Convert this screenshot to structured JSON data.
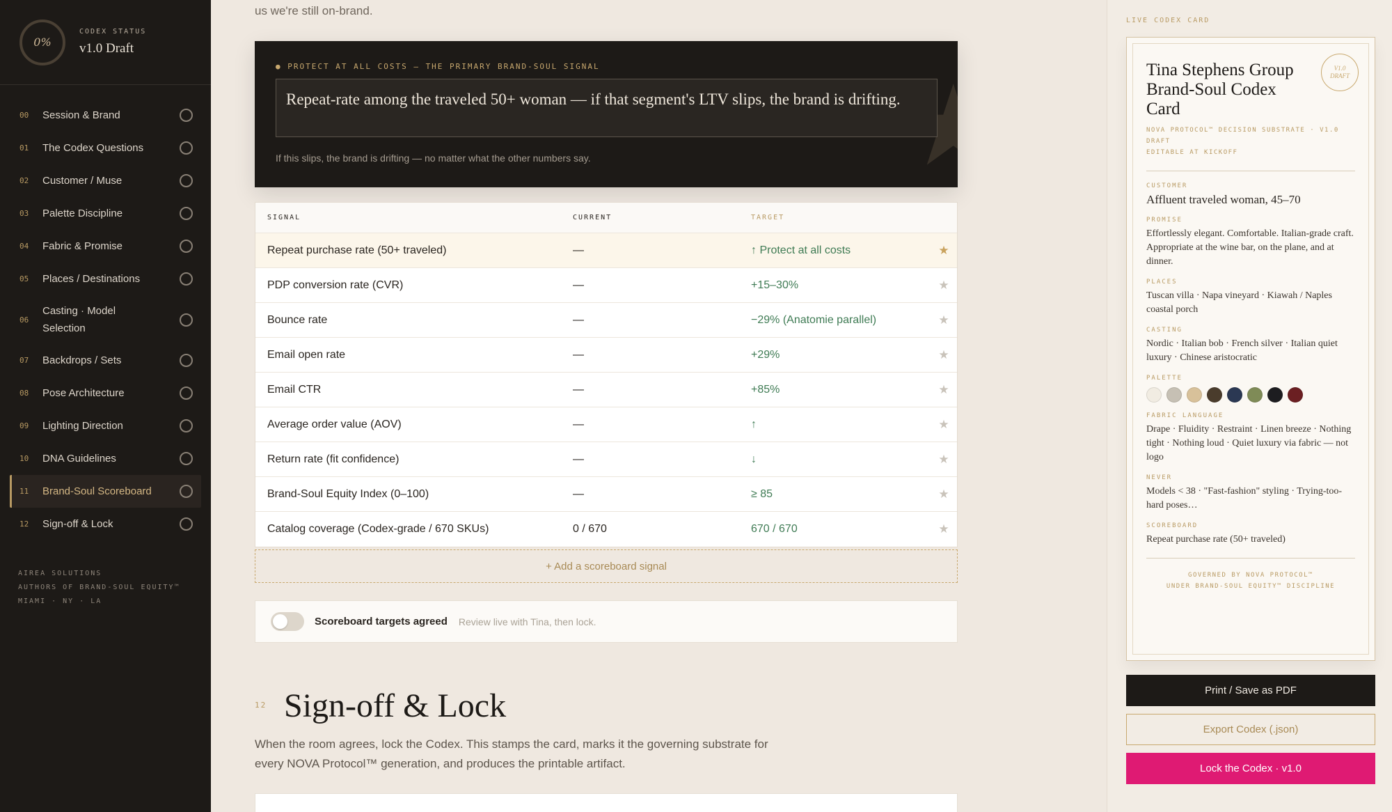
{
  "sidebar": {
    "status_percent": "0%",
    "status_label": "CODEX STATUS",
    "status_value": "v1.0 Draft",
    "items": [
      {
        "num": "00",
        "label": "Session & Brand"
      },
      {
        "num": "01",
        "label": "The Codex Questions"
      },
      {
        "num": "02",
        "label": "Customer / Muse"
      },
      {
        "num": "03",
        "label": "Palette Discipline"
      },
      {
        "num": "04",
        "label": "Fabric & Promise"
      },
      {
        "num": "05",
        "label": "Places / Destinations"
      },
      {
        "num": "06",
        "label": "Casting · Model Selection"
      },
      {
        "num": "07",
        "label": "Backdrops / Sets"
      },
      {
        "num": "08",
        "label": "Pose Architecture"
      },
      {
        "num": "09",
        "label": "Lighting Direction"
      },
      {
        "num": "10",
        "label": "DNA Guidelines"
      },
      {
        "num": "11",
        "label": "Brand-Soul Scoreboard",
        "active": true
      },
      {
        "num": "12",
        "label": "Sign-off & Lock"
      }
    ],
    "company": [
      "AIREA SOLUTIONS",
      "AUTHORS OF BRAND-SOUL EQUITY™",
      "MIAMI · NY · LA"
    ]
  },
  "main": {
    "intro_tail": "us we're still on-brand.",
    "primary": {
      "eyebrow": "● PROTECT AT ALL COSTS — THE PRIMARY BRAND-SOUL SIGNAL",
      "quote": "Repeat-rate among the traveled 50+ woman — if that segment's LTV slips, the brand is drifting.",
      "note": "If this slips, the brand is drifting — no matter what the other numbers say."
    },
    "table": {
      "headers": [
        "SIGNAL",
        "CURRENT",
        "TARGET"
      ],
      "rows": [
        {
          "signal": "Repeat purchase rate (50+ traveled)",
          "current": "—",
          "target": "↑ Protect at all costs",
          "highlight": true
        },
        {
          "signal": "PDP conversion rate (CVR)",
          "current": "—",
          "target": "+15–30%"
        },
        {
          "signal": "Bounce rate",
          "current": "—",
          "target": "−29% (Anatomie parallel)"
        },
        {
          "signal": "Email open rate",
          "current": "—",
          "target": "+29%"
        },
        {
          "signal": "Email CTR",
          "current": "—",
          "target": "+85%"
        },
        {
          "signal": "Average order value (AOV)",
          "current": "—",
          "target": "↑"
        },
        {
          "signal": "Return rate (fit confidence)",
          "current": "—",
          "target": "↓"
        },
        {
          "signal": "Brand-Soul Equity Index (0–100)",
          "current": "—",
          "target": "≥ 85"
        },
        {
          "signal": "Catalog coverage (Codex-grade / 670 SKUs)",
          "current": "0 / 670",
          "target": "670 / 670"
        }
      ]
    },
    "add_signal": "+ Add a scoreboard signal",
    "agree_label": "Scoreboard targets agreed",
    "agree_hint": "Review live with Tina, then lock.",
    "section_num": "12",
    "section_title": "Sign-off & Lock",
    "section_desc": "When the room agrees, lock the Codex. This stamps the card, marks it the governing substrate for every NOVA Protocol™ generation, and produces the printable artifact."
  },
  "card": {
    "panel_label": "LIVE CODEX CARD",
    "title": "Tina Stephens Group Brand-Soul Codex Card",
    "seal_line1": "V1.0",
    "seal_line2": "DRAFT",
    "sub1": "NOVA PROTOCOL™ DECISION SUBSTRATE · V1.0",
    "sub2": "DRAFT",
    "sub3": "EDITABLE AT KICKOFF",
    "customer_label": "CUSTOMER",
    "customer": "Affluent traveled woman, 45–70",
    "promise_label": "PROMISE",
    "promise": "Effortlessly elegant. Comfortable. Italian-grade craft. Appropriate at the wine bar, on the plane, and at dinner.",
    "places_label": "PLACES",
    "places": "Tuscan villa · Napa vineyard · Kiawah / Naples coastal porch",
    "casting_label": "CASTING",
    "casting": "Nordic · Italian bob · French silver · Italian quiet luxury · Chinese aristocratic",
    "palette_label": "PALETTE",
    "palette": [
      "#f1ece2",
      "#c6c0b4",
      "#d8c19a",
      "#4a3c2c",
      "#2b3853",
      "#7f8b57",
      "#1d1d20",
      "#6b1f22"
    ],
    "fabric_label": "FABRIC LANGUAGE",
    "fabric": "Drape · Fluidity · Restraint · Linen breeze · Nothing tight · Nothing loud · Quiet luxury via fabric — not logo",
    "never_label": "NEVER",
    "never": "Models < 38 · \"Fast-fashion\" styling · Trying-too-hard poses…",
    "scoreboard_label": "SCOREBOARD",
    "scoreboard": "Repeat purchase rate (50+ traveled)",
    "footer1": "GOVERNED BY NOVA PROTOCOL™",
    "footer2": "UNDER BRAND-SOUL EQUITY™ DISCIPLINE"
  },
  "actions": {
    "print": "Print / Save as PDF",
    "export": "Export Codex (.json)",
    "lock": "Lock the Codex · v1.0"
  }
}
